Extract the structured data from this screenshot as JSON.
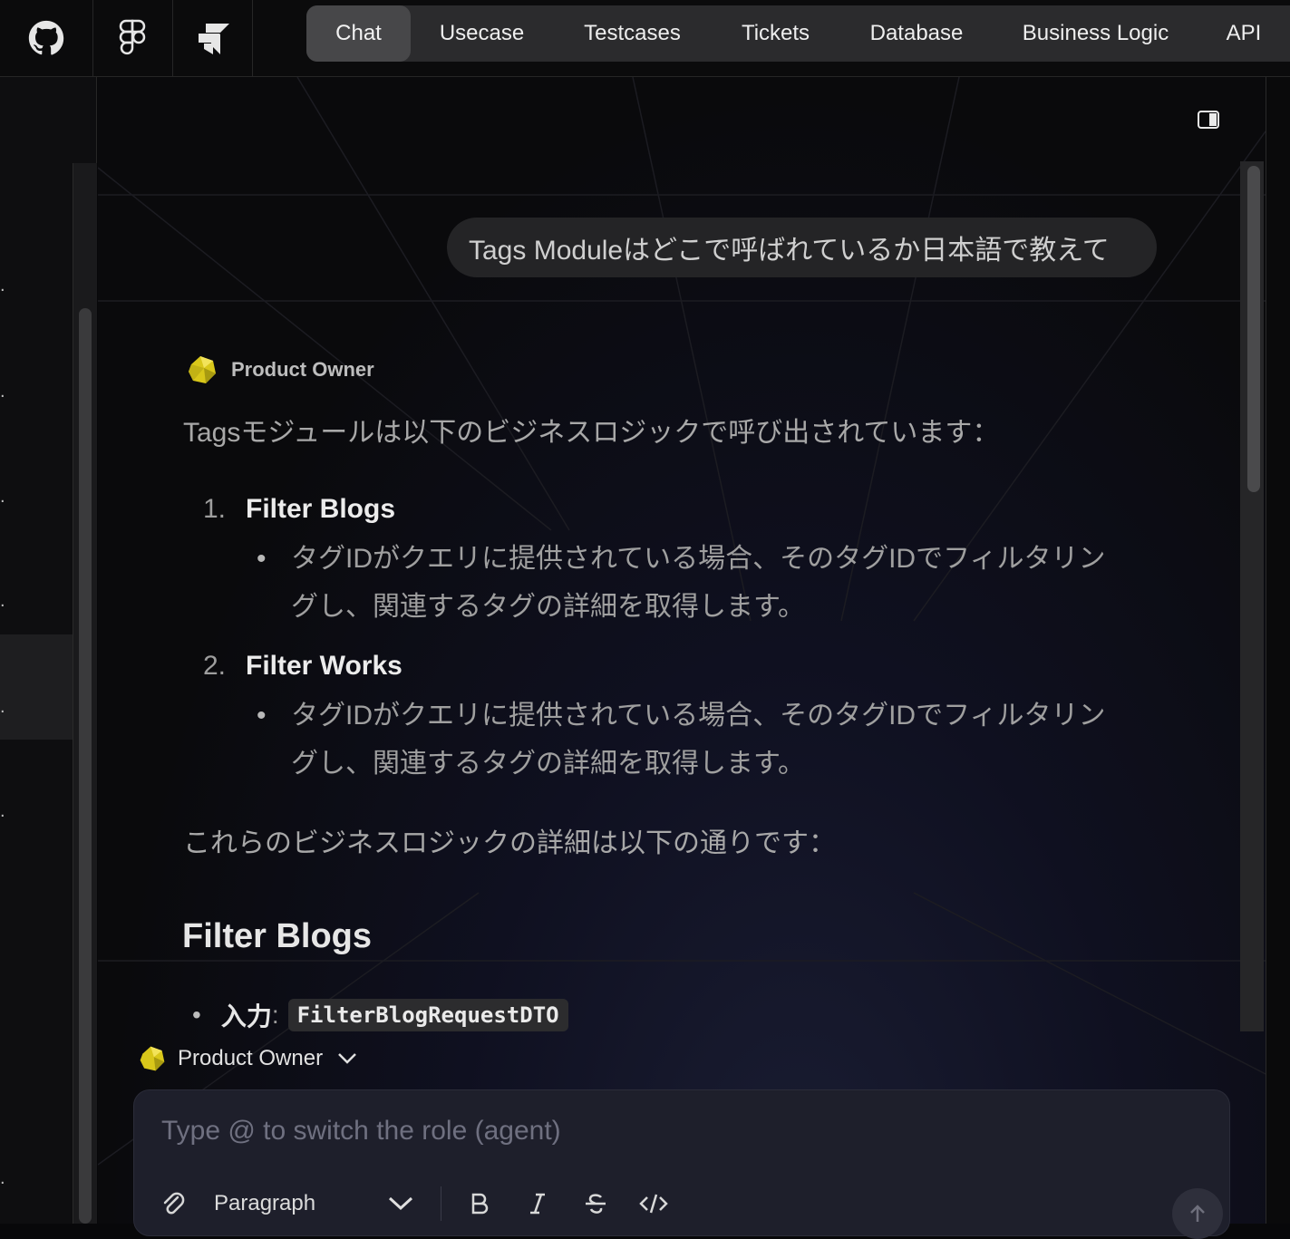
{
  "nav": {
    "tabs": [
      {
        "label": "Chat",
        "active": true
      },
      {
        "label": "Usecase"
      },
      {
        "label": "Testcases"
      },
      {
        "label": "Tickets"
      },
      {
        "label": "Database"
      },
      {
        "label": "Business Logic"
      },
      {
        "label": "API"
      }
    ],
    "icons": [
      "github-icon",
      "figma-icon",
      "jira-icon"
    ]
  },
  "chat": {
    "user_message": "Tags Moduleはどこで呼ばれているか日本語で教えて",
    "agent_name": "Product Owner",
    "intro": "Tagsモジュールは以下のビジネスロジックで呼び出されています：",
    "items": [
      {
        "num": "1.",
        "title": "Filter Blogs",
        "bullet": "タグIDがクエリに提供されている場合、そのタグIDでフィルタリングし、関連するタグの詳細を取得します。"
      },
      {
        "num": "2.",
        "title": "Filter Works",
        "bullet": "タグIDがクエリに提供されている場合、そのタグIDでフィルタリングし、関連するタグの詳細を取得します。"
      }
    ],
    "outro": "これらのビジネスロジックの詳細は以下の通りです：",
    "section_title": "Filter Blogs",
    "input_label": "入力",
    "input_colon": ":",
    "input_value": "FilterBlogRequestDTO"
  },
  "composer": {
    "role": "Product Owner",
    "placeholder": "Type @ to switch the role (agent)",
    "paragraph_label": "Paragraph"
  },
  "colors": {
    "background": "#08080a",
    "tab_bar": "#2b2b2d",
    "tab_active": "#474749",
    "composer": "#1e1f2b",
    "agent_avatar": "#d4c41a"
  }
}
